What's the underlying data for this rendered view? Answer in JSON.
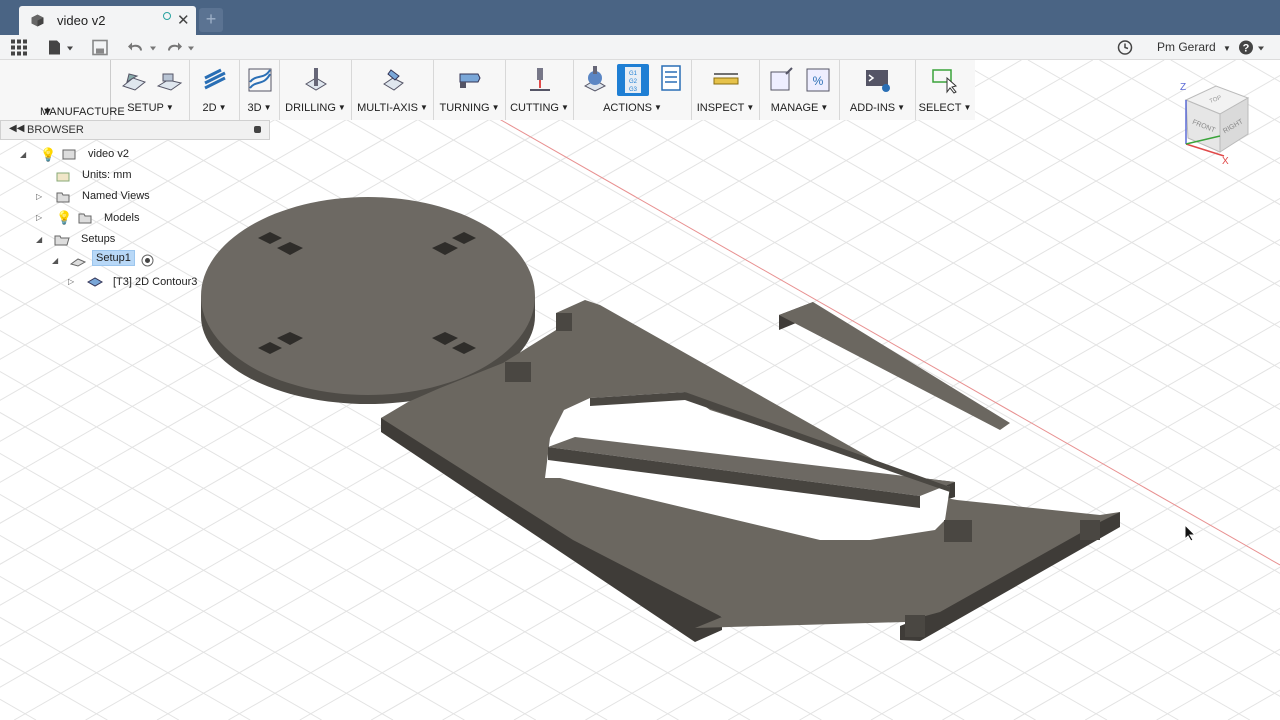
{
  "document": {
    "tab_title": "video v2",
    "new_tab_symbol": "+"
  },
  "quick_access": {
    "user_name": "Pm Gerard"
  },
  "toolbar": {
    "workspace": "MANUFACTURE",
    "groups": [
      {
        "label": "SETUP"
      },
      {
        "label": "2D"
      },
      {
        "label": "3D"
      },
      {
        "label": "DRILLING"
      },
      {
        "label": "MULTI-AXIS"
      },
      {
        "label": "TURNING"
      },
      {
        "label": "CUTTING"
      },
      {
        "label": "ACTIONS"
      },
      {
        "label": "INSPECT"
      },
      {
        "label": "MANAGE"
      },
      {
        "label": "ADD-INS"
      },
      {
        "label": "SELECT"
      }
    ],
    "actions_icon_text": [
      "G1",
      "G2",
      "G3"
    ],
    "manage_icon_text": "%"
  },
  "browser": {
    "title": "BROWSER",
    "items": [
      {
        "label": "video v2"
      },
      {
        "label": "Units: mm"
      },
      {
        "label": "Named Views"
      },
      {
        "label": "Models"
      },
      {
        "label": "Setups"
      },
      {
        "label": "Setup1"
      },
      {
        "label": "[T3] 2D Contour3"
      }
    ]
  },
  "viewcube": {
    "top": "TOP",
    "front": "FRONT",
    "right": "RIGHT",
    "axis_z": "Z",
    "axis_x": "X"
  },
  "colors": {
    "tabbar": "#4a6484",
    "part": "#6b6760",
    "accent_selection": "#b8d8f7",
    "axis_red": "#e07a7a"
  }
}
